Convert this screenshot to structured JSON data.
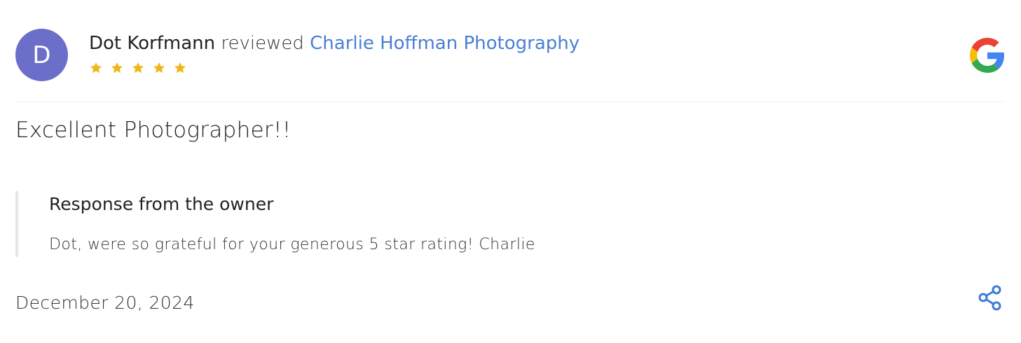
{
  "review": {
    "avatar_letter": "D",
    "avatar_color": "#6b6fc9",
    "reviewer_name": "Dot Korfmann",
    "reviewed_word": "reviewed",
    "business_name": "Charlie Hoffman Photography",
    "business_link_color": "#4a7fd4",
    "rating": 5,
    "star_color": "#f2b517",
    "title": "Excellent Photographer!!",
    "date": "December 20, 2024"
  },
  "owner_response": {
    "heading": "Response from the owner",
    "text": "Dot, were so grateful for your generous 5 star rating! Charlie"
  },
  "icons": {
    "source_logo": "google-logo-icon",
    "share": "share-icon"
  },
  "colors": {
    "share_icon": "#3b7bd8"
  }
}
